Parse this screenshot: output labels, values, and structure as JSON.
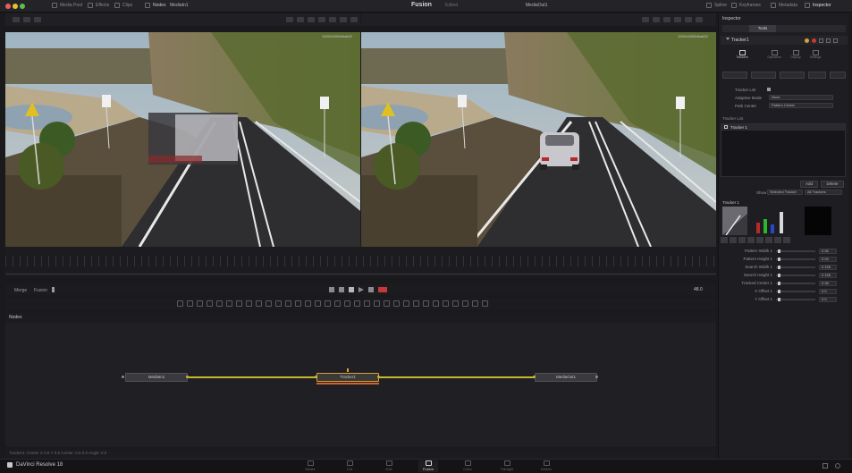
{
  "titlebar": {
    "app_title": "Fusion",
    "app_subtitle": "Edited",
    "left_items": [
      "Media Pool",
      "Effects",
      "Clips",
      "Nodes"
    ],
    "right_items": [
      "Spline",
      "Keyframes",
      "Metadata",
      "Inspector"
    ]
  },
  "viewers": {
    "left_title": "MediaIn1",
    "right_title": "MediaOut1",
    "left_res": "1920x1080xfloat32",
    "right_res": "1920x1080xfloat32"
  },
  "transport": {
    "left_label_1": "Merge",
    "left_label_2": "Fusion",
    "timecode": "48.0",
    "frame": "48.0"
  },
  "nodes": {
    "header_label": "Nodes",
    "node_left": "MediaIn1",
    "node_center": "Tracker1",
    "node_right": "MediaOut1"
  },
  "statusbar": {
    "text": "Tracker1: Center X    0.5    Y    0.5    Center: 0.5    0.5    Angle: 0.0",
    "right": "4% - 2.61 GB"
  },
  "brand": {
    "label": "DaVinci Resolve 18"
  },
  "pages": [
    "Media",
    "Cut",
    "Edit",
    "Fusion",
    "Color",
    "Fairlight",
    "Deliver"
  ],
  "active_page": 3,
  "inspector": {
    "title": "Inspector",
    "tool_tab": "Tools",
    "node_name": "Tracker1",
    "subtabs": [
      "Trackers",
      "Operation",
      "Display",
      "Settings"
    ],
    "fields": [
      {
        "label": "Tracker List",
        "value": ""
      },
      {
        "label": "Adaptive Mode",
        "value": "None"
      },
      {
        "label": "Path Center",
        "value": "Pattern Center"
      }
    ],
    "tracker_list_item": "Tracker 1",
    "add_button": "Add",
    "delete_button": "Delete",
    "show_label": "Show",
    "show_value": "Selected Tracker",
    "show_value_2": "All Trackers",
    "tracker_name": "Tracker 1",
    "params": [
      {
        "label": "Pattern Width 1",
        "value": "0.06"
      },
      {
        "label": "Pattern Height 1",
        "value": "0.04"
      },
      {
        "label": "Search Width 1",
        "value": "0.155"
      },
      {
        "label": "Search Height 1",
        "value": "0.155"
      },
      {
        "label": "Tracked Center 1",
        "value": "0.38"
      },
      {
        "label": "X Offset 1",
        "value": "0.0"
      },
      {
        "label": "Y Offset 1",
        "value": "0.0"
      }
    ]
  },
  "colors": {
    "bg": "#1a1a1c",
    "accent": "#d6a040",
    "node_link": "#c8b830",
    "red": "#c83838",
    "green": "#38c838",
    "blue": "#3858d8"
  }
}
